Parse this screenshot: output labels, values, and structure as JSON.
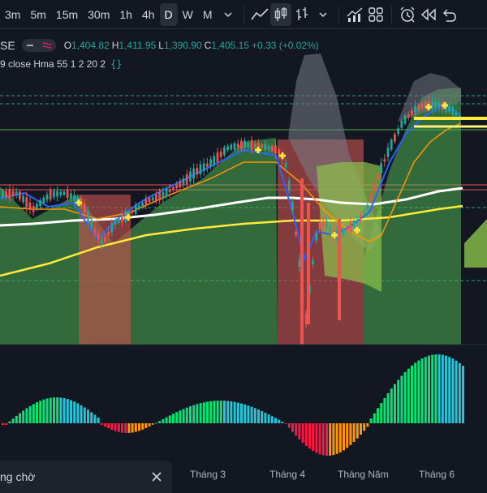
{
  "toolbar": {
    "timeframes": [
      {
        "label": "3m",
        "active": false
      },
      {
        "label": "5m",
        "active": false
      },
      {
        "label": "15m",
        "active": false
      },
      {
        "label": "30m",
        "active": false
      },
      {
        "label": "1h",
        "active": false
      },
      {
        "label": "4h",
        "active": false
      },
      {
        "label": "D",
        "active": true
      },
      {
        "label": "W",
        "active": false
      },
      {
        "label": "M",
        "active": false
      }
    ],
    "icons": [
      "chevron-down-icon",
      "line-chart-icon",
      "candles-icon",
      "bars-icon",
      "chevron-down-icon",
      "indicators-icon",
      "templates-icon",
      "alert-icon",
      "replay-icon",
      "undo-icon"
    ]
  },
  "legend": {
    "symbol": "SE",
    "open_label": "O",
    "open": "1,404.82",
    "high_label": "H",
    "high": "1,411.95",
    "low_label": "L",
    "low": "1,390.90",
    "close_label": "C",
    "close": "1,405.15",
    "change": "+0.33 (+0.02%)",
    "indicator": "9 close Hma 55 1 2 20 2",
    "indicator_code_icon": "{}"
  },
  "xaxis": {
    "labels": [
      "Tháng 3",
      "Tháng 4",
      "Tháng Năm",
      "Tháng 6"
    ]
  },
  "toast": {
    "text": "ng chờ"
  },
  "colors": {
    "up": "#26a69a",
    "down": "#ef5350",
    "histogram_up_bright": "#00e676",
    "histogram_up_fade": "#26c6da",
    "histogram_down_bright": "#ff1744",
    "histogram_down_fade": "#ff9800",
    "ma_white": "#ffffff",
    "ma_yellow": "#ffeb3b",
    "ma_orange": "#ff9800",
    "ma_blue": "#2962ff"
  }
}
